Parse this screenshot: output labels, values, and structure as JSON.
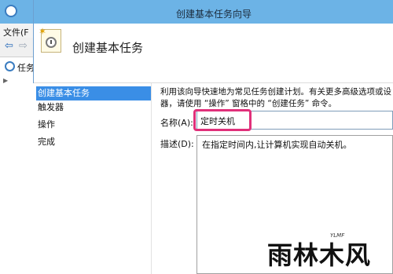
{
  "background_app": {
    "menu": {
      "file_label": "文件(F"
    },
    "tree": {
      "root_label": "任务"
    }
  },
  "dialog": {
    "title": "创建基本任务向导",
    "heading": "创建基本任务",
    "steps": [
      {
        "label": "创建基本任务",
        "active": true
      },
      {
        "label": "触发器",
        "active": false
      },
      {
        "label": "操作",
        "active": false
      },
      {
        "label": "完成",
        "active": false
      }
    ],
    "description_lines": [
      "利用该向导快速地为常见任务创建计划。有关更多高级选项或设",
      "器，请使用 “操作” 窗格中的 “创建任务” 命令。"
    ],
    "name_label": "名称(A):",
    "name_value": "定时关机",
    "desc_label": "描述(D):",
    "desc_value": "在指定时间内,让计算机实现自动关机。"
  },
  "watermark": {
    "text": "雨林木风",
    "sub": "YLMF"
  },
  "colors": {
    "titlebar": "#6cb3e6",
    "step_active": "#3a8ee6",
    "highlight": "#e0307a"
  }
}
